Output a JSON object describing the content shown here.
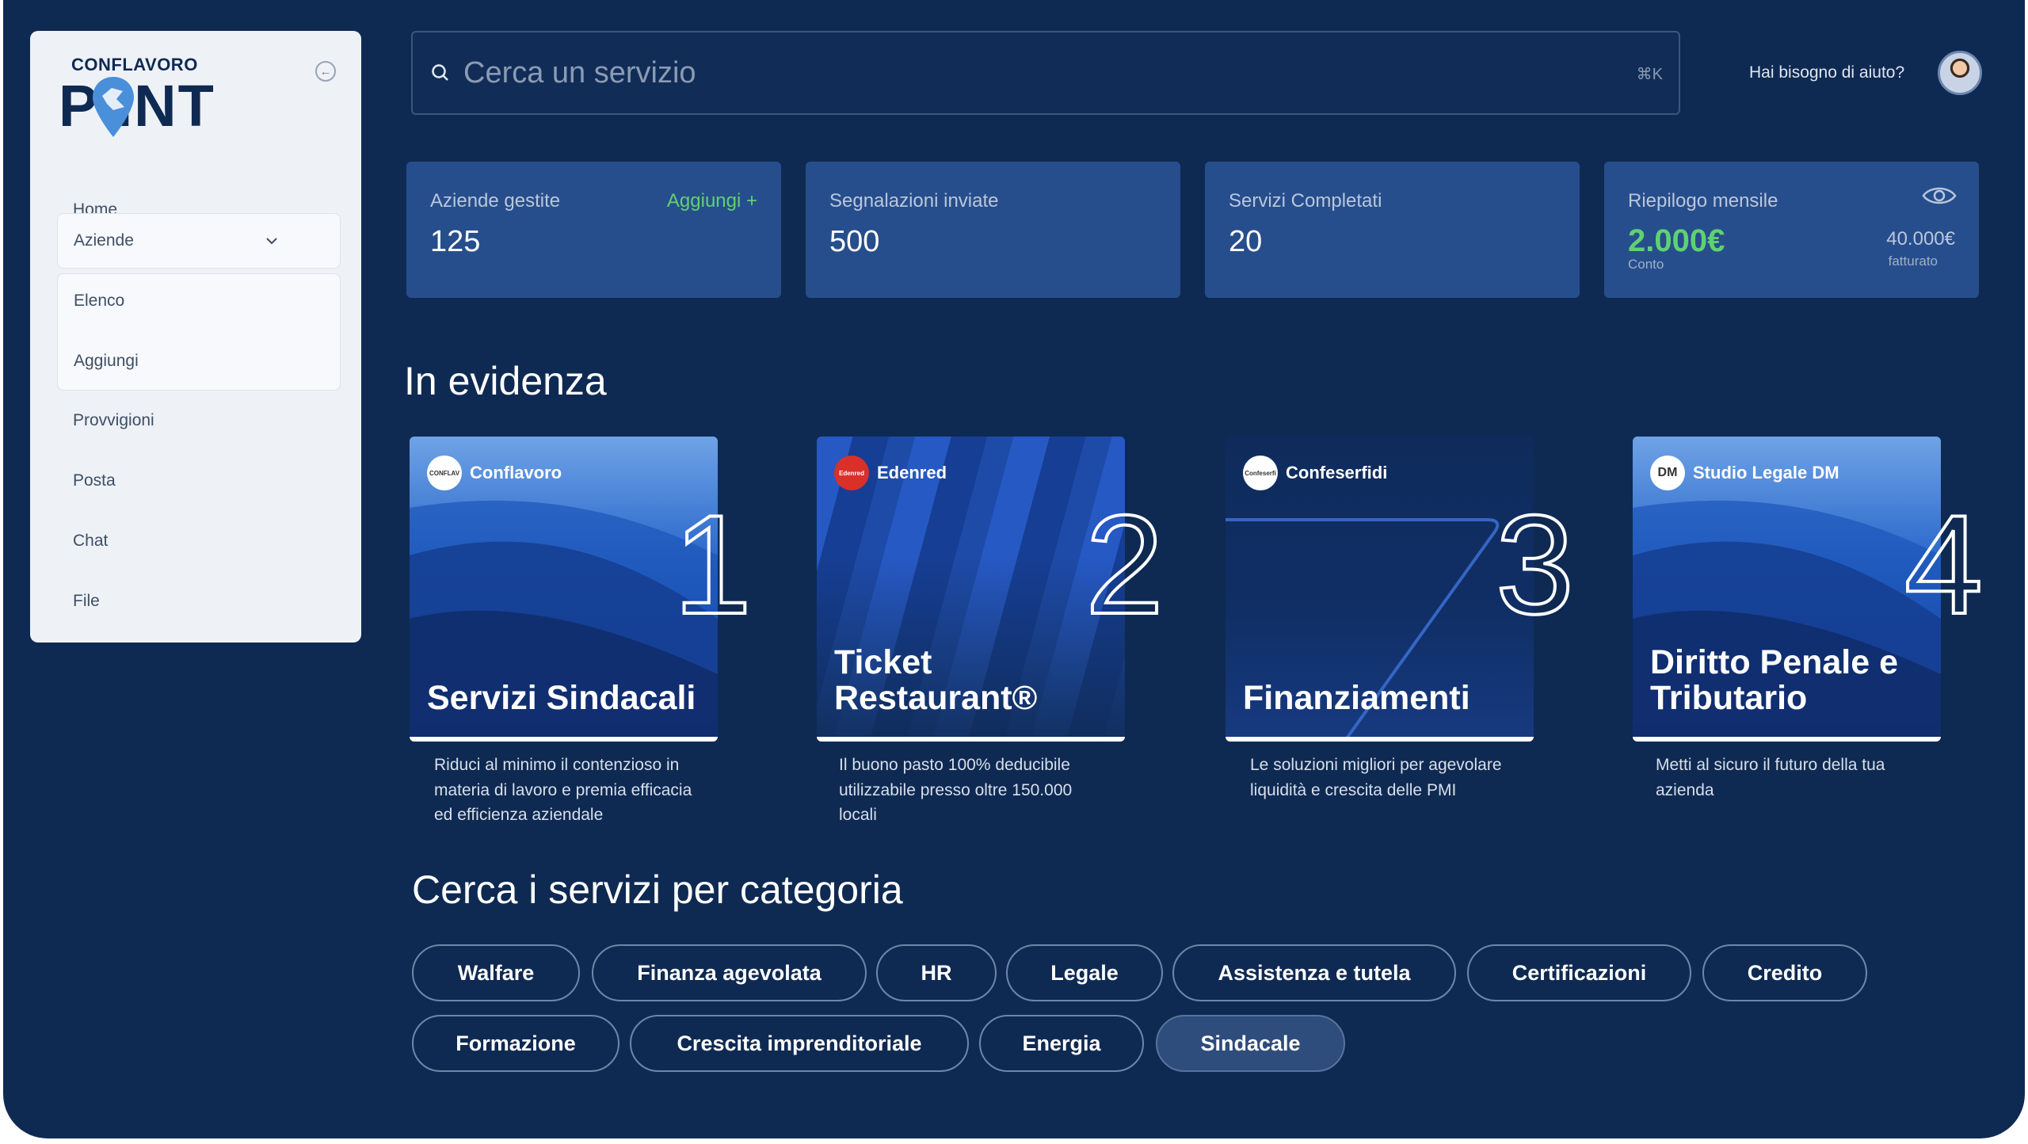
{
  "sidebar": {
    "logo_top": "CONFLAVORO",
    "logo_main": "P INT",
    "nav": {
      "home": "Home",
      "aziende": "Aziende",
      "elenco": "Elenco",
      "aggiungi": "Aggiungi",
      "provvigioni": "Provvigioni",
      "posta": "Posta",
      "chat": "Chat",
      "file": "File"
    }
  },
  "header": {
    "search_placeholder": "Cerca un servizio",
    "search_shortcut": "⌘K",
    "help": "Hai bisogno di aiuto?"
  },
  "stats": {
    "aziende": {
      "title": "Aziende gestite",
      "value": "125",
      "action": "Aggiungi +"
    },
    "segnalazioni": {
      "title": "Segnalazioni inviate",
      "value": "500"
    },
    "servizi": {
      "title": "Servizi Completati",
      "value": "20"
    },
    "riepilogo": {
      "title": "Riepilogo mensile",
      "conto_value": "2.000€",
      "conto_label": "Conto",
      "fatturato_value": "40.000€",
      "fatturato_label": "fatturato"
    }
  },
  "highlights": {
    "title": "In evidenza",
    "cards": [
      {
        "brand": "Conflavoro",
        "logo_text": "CONFLAV",
        "title": "Servizi Sindacali",
        "number": "1",
        "description": "Riduci al minimo il contenzioso in materia di lavoro e premia efficacia ed efficienza aziendale"
      },
      {
        "brand": "Edenred",
        "logo_text": "Edenred",
        "title": "Ticket Restaurant®",
        "number": "2",
        "description": "Il buono pasto 100% deducibile utilizzabile presso oltre 150.000 locali"
      },
      {
        "brand": "Confeserfidi",
        "logo_text": "Confeserfi",
        "title": "Finanziamenti",
        "number": "3",
        "description": "Le soluzioni migliori per agevolare liquidità e crescita delle PMI"
      },
      {
        "brand": "Studio Legale DM",
        "logo_text": "DM",
        "title": "Diritto Penale e Tributario",
        "number": "4",
        "description": "Metti al sicuro il futuro della tua azienda"
      }
    ]
  },
  "categories": {
    "title": "Cerca i servizi per categoria",
    "items": [
      "Walfare",
      "Finanza agevolata",
      "HR",
      "Legale",
      "Assistenza e tutela",
      "Certificazioni",
      "Credito",
      "Formazione",
      "Crescita imprenditoriale",
      "Energia",
      "Sindacale"
    ],
    "active": "Sindacale"
  },
  "colors": {
    "background": "#0f2a52",
    "stat_card": "#274e8c",
    "accent_green": "#5fd173",
    "sidebar": "#eef2f7"
  }
}
